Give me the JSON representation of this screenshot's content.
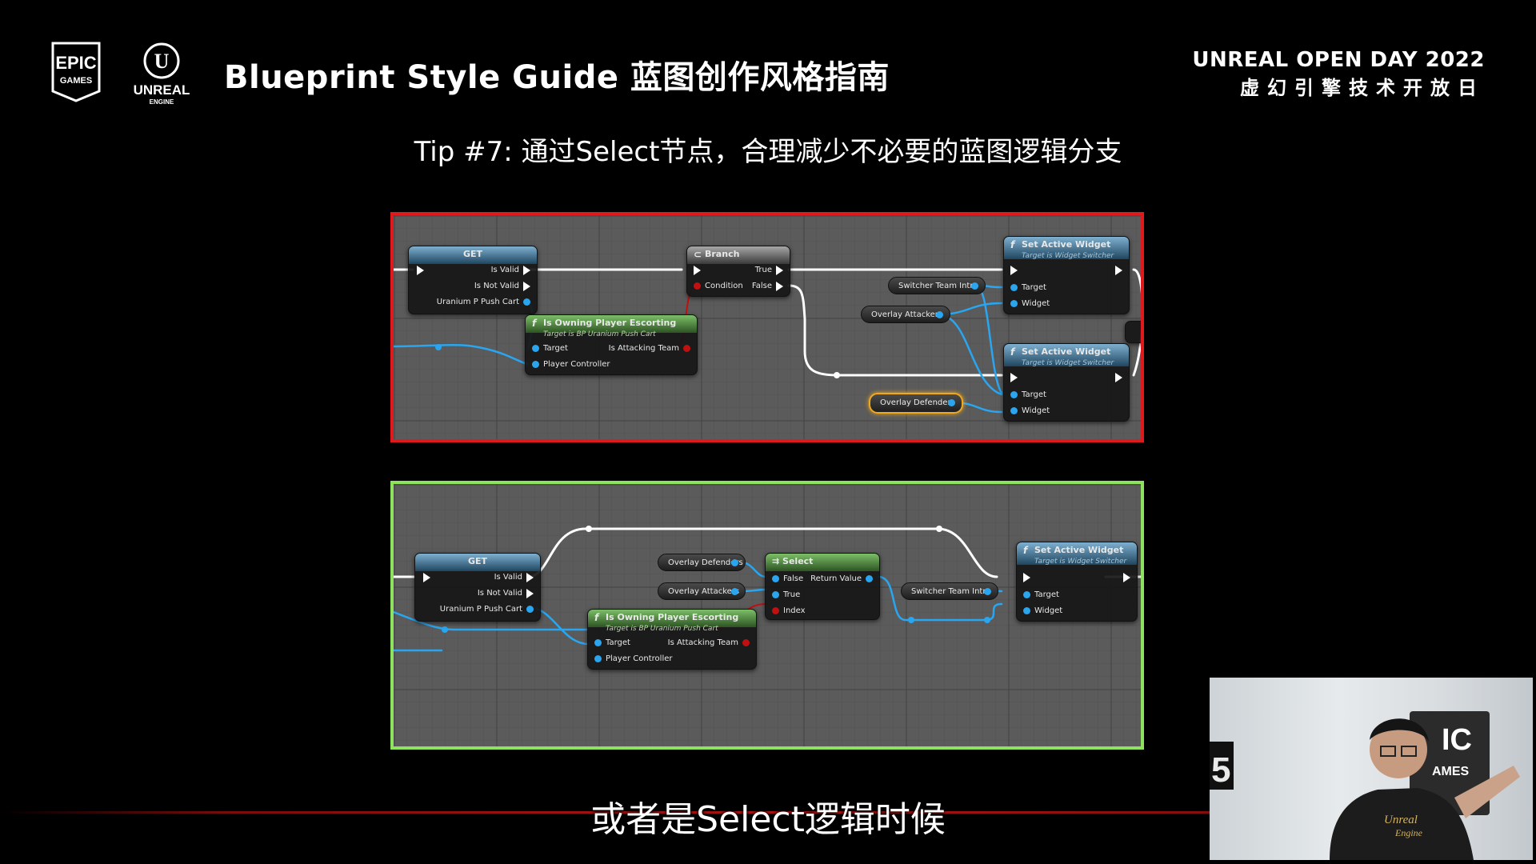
{
  "header": {
    "epic_logo_text": [
      "EPIC",
      "GAMES"
    ],
    "unreal_logo_text": [
      "UNREAL",
      "ENGINE"
    ],
    "title": "Blueprint Style Guide 蓝图创作风格指南",
    "event_name": "UNREAL OPEN DAY 2022",
    "event_sub": "虚幻引擎技术开放日"
  },
  "tip": "Tip #7: 通过Select节点，合理减少不必要的蓝图逻辑分支",
  "bad_example": {
    "get_node": {
      "title": "GET",
      "pins": [
        "Is Valid",
        "Is Not Valid",
        "Uranium P Push Cart"
      ]
    },
    "branch_node": {
      "title": "Branch",
      "pins": [
        "Condition",
        "True",
        "False"
      ]
    },
    "owning_node": {
      "title": "Is Owning Player Escorting",
      "subtitle": "Target is BP Uranium Push Cart",
      "pins": [
        "Target",
        "Player Controller",
        "Is Attacking Team"
      ]
    },
    "set_widget_1": {
      "title": "Set Active Widget",
      "subtitle": "Target is Widget Switcher",
      "pins": [
        "Target",
        "Widget"
      ]
    },
    "set_widget_2": {
      "title": "Set Active Widget",
      "subtitle": "Target is Widget Switcher",
      "pins": [
        "Target",
        "Widget"
      ]
    },
    "vars": [
      "Switcher Team Intro",
      "Overlay Attackers",
      "Overlay Defenders"
    ]
  },
  "good_example": {
    "get_node": {
      "title": "GET",
      "pins": [
        "Is Valid",
        "Is Not Valid",
        "Uranium P Push Cart"
      ]
    },
    "owning_node": {
      "title": "Is Owning Player Escorting",
      "subtitle": "Target is BP Uranium Push Cart",
      "pins": [
        "Target",
        "Player Controller",
        "Is Attacking Team"
      ]
    },
    "select_node": {
      "title": "Select",
      "pins": [
        "False",
        "True",
        "Index",
        "Return Value"
      ]
    },
    "set_widget": {
      "title": "Set Active Widget",
      "subtitle": "Target is Widget Switcher",
      "pins": [
        "Target",
        "Widget"
      ]
    },
    "vars": [
      "Overlay Defenders",
      "Overlay Attackers",
      "Switcher Team Intro"
    ]
  },
  "subtitle": "或者是Select逻辑时候",
  "webcam": {
    "shirt_text": [
      "Unreal",
      "Engine"
    ],
    "backdrop_text": [
      "IC",
      "AMES"
    ]
  },
  "colors": {
    "bad_border": "#e0191c",
    "good_border": "#8fe25e",
    "object_pin": "#29a6ef",
    "bool_pin": "#c0100f"
  }
}
